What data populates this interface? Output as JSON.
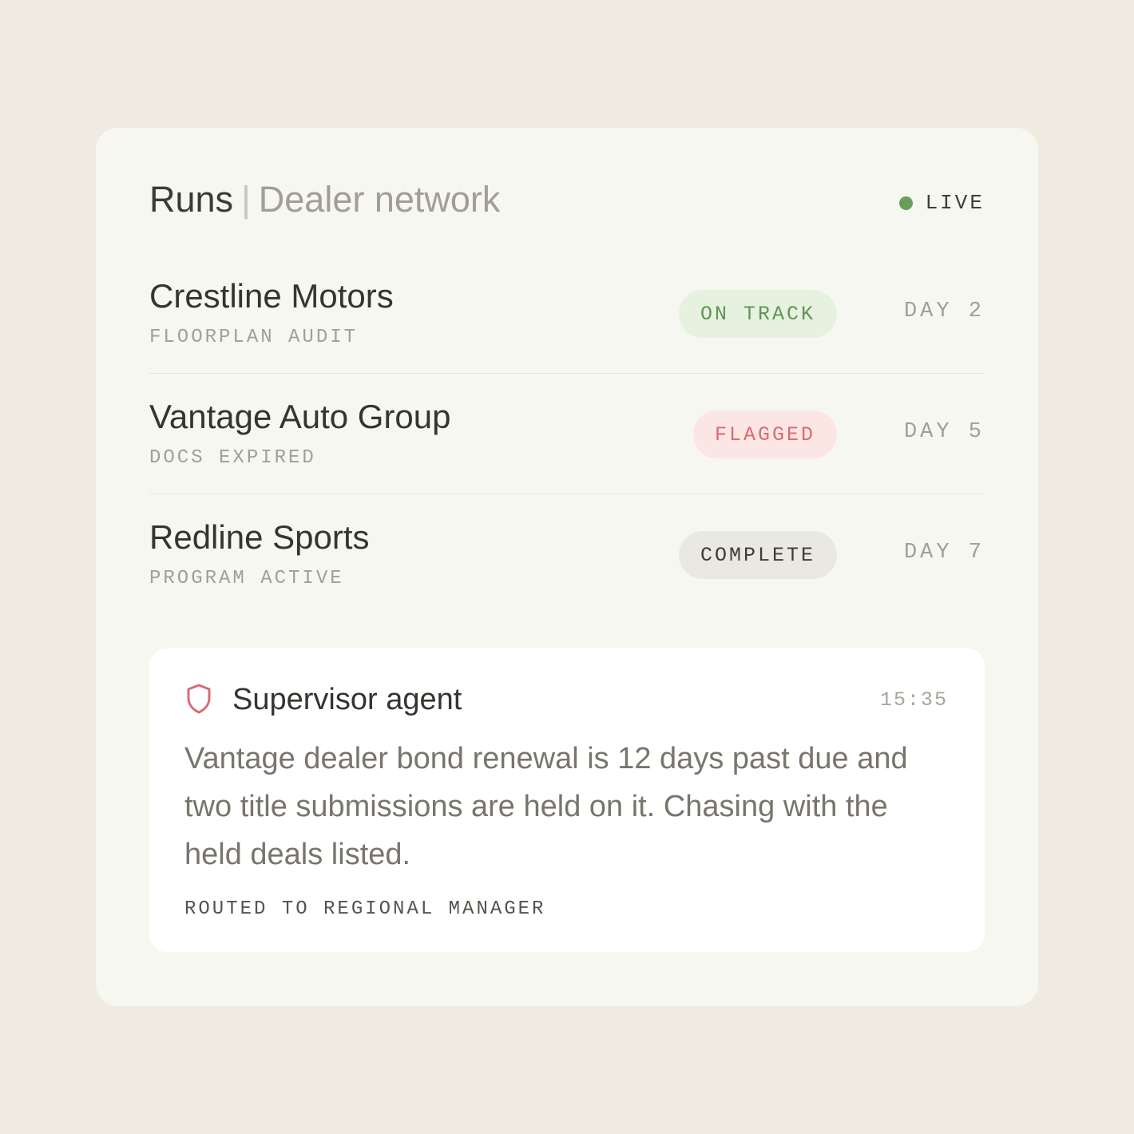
{
  "header": {
    "title": "Runs",
    "separator": "|",
    "subtitle": "Dealer network",
    "live_label": "LIVE",
    "live_color": "#6a9d5a"
  },
  "runs": [
    {
      "name": "Crestline Motors",
      "description": "FLOORPLAN AUDIT",
      "status": "ON TRACK",
      "status_color": "#5f9552",
      "day": "DAY 2"
    },
    {
      "name": "Vantage Auto Group",
      "description": "DOCS EXPIRED",
      "status": "FLAGGED",
      "status_color": "#d86b71",
      "day": "DAY 5"
    },
    {
      "name": "Redline Sports",
      "description": "PROGRAM ACTIVE",
      "status": "COMPLETE",
      "status_color": "#3d3c37",
      "day": "DAY 7"
    }
  ],
  "agent": {
    "icon": "shield-icon",
    "icon_color": "#d86b71",
    "name": "Supervisor agent",
    "time": "15:35",
    "message": "Vantage dealer bond renewal is 12 days past due and two title submissions are held on it. Chasing with the held deals listed.",
    "routed": "ROUTED TO REGIONAL MANAGER"
  }
}
